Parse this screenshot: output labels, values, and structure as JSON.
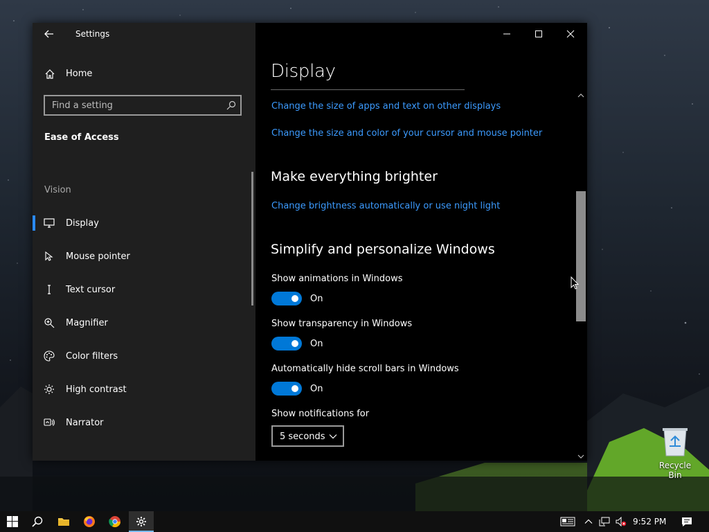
{
  "window": {
    "app_title": "Settings"
  },
  "sidebar": {
    "home_label": "Home",
    "search_placeholder": "Find a setting",
    "section_title": "Ease of Access",
    "group_label": "Vision",
    "items": [
      {
        "label": "Display",
        "icon": "monitor-icon",
        "active": true
      },
      {
        "label": "Mouse pointer",
        "icon": "mouse-pointer-icon"
      },
      {
        "label": "Text cursor",
        "icon": "text-cursor-icon"
      },
      {
        "label": "Magnifier",
        "icon": "magnifier-icon"
      },
      {
        "label": "Color filters",
        "icon": "color-filters-icon"
      },
      {
        "label": "High contrast",
        "icon": "high-contrast-icon"
      },
      {
        "label": "Narrator",
        "icon": "narrator-icon"
      }
    ]
  },
  "content": {
    "page_title": "Display",
    "links_top": [
      "Change the size of apps and text on other displays",
      "Change the size and color of your cursor and mouse pointer"
    ],
    "brighter_heading": "Make everything brighter",
    "brighter_link": "Change brightness automatically or use night light",
    "simplify_heading": "Simplify and personalize Windows",
    "settings": [
      {
        "label": "Show animations in Windows",
        "state": "On"
      },
      {
        "label": "Show transparency in Windows",
        "state": "On"
      },
      {
        "label": "Automatically hide scroll bars in Windows",
        "state": "On"
      }
    ],
    "notifications_label": "Show notifications for",
    "notifications_value": "5 seconds"
  },
  "desktop": {
    "recycle_bin_label": "Recycle Bin"
  },
  "taskbar": {
    "clock": "9:52 PM",
    "accent": "#0078d7"
  },
  "colors": {
    "link": "#3c9bff",
    "toggle_on": "#0078d7",
    "active_indicator": "#2a8af6"
  }
}
